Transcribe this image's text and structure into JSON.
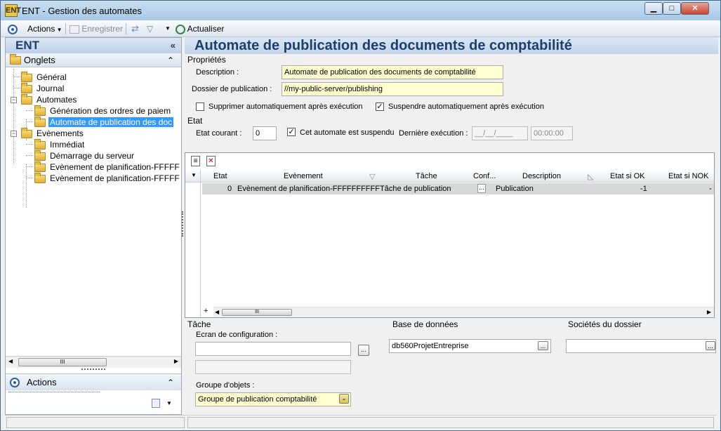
{
  "window": {
    "app_name": "ENT",
    "title": "ENT -  Gestion des automates",
    "minimize": "▁",
    "maximize": "□",
    "close": "✕"
  },
  "toolbar": {
    "actions_label": "Actions",
    "save_label": "Enregistrer",
    "refresh_label": "Actualiser"
  },
  "left": {
    "header": "ENT",
    "collapse_icon": "«",
    "onglets_label": "Onglets",
    "expand_icon": "⌃",
    "tree": [
      {
        "label": "Général"
      },
      {
        "label": "Journal"
      },
      {
        "label": "Automates"
      },
      {
        "label": "Génération des ordres de paiem"
      },
      {
        "label": "Automate de publication des doc"
      },
      {
        "label": "Evènements"
      },
      {
        "label": "Immédiat"
      },
      {
        "label": "Démarrage du serveur"
      },
      {
        "label": "Evènement de planification-FFFFF"
      },
      {
        "label": "Evènement de planification-FFFFF"
      }
    ],
    "actions_label": "Actions"
  },
  "main": {
    "title": "Automate de publication des documents de comptabilité",
    "proprietes_label": "Propriétés",
    "description_label": "Description :",
    "description_value": "Automate de publication des documents de comptabilité",
    "dossier_label": "Dossier de publication :",
    "dossier_value": "//my-public-server/publishing",
    "supprimer_label": "Supprimer automatiquement après exécution",
    "supprimer_checked": false,
    "suspendre_label": "Suspendre automatiquement après exécution",
    "suspendre_checked": true,
    "etat_label": "Etat",
    "etat_courant_label": "Etat courant :",
    "etat_courant_value": "0",
    "suspendu_label": "Cet automate est suspendu",
    "suspendu_checked": true,
    "derniere_label": "Dernière exécution :",
    "derniere_date": "__/__/____",
    "derniere_time": "00:00:00"
  },
  "grid": {
    "columns": [
      "Etat",
      "Evènement",
      "Tâche",
      "Conf...",
      "Description",
      "Etat si OK",
      "Etat si NOK"
    ],
    "rows": [
      {
        "etat": "0",
        "evenement": "Evènement de planification-FFFFFFFFFF",
        "tache": "Tâche de publication",
        "conf": "...",
        "description": "Publication",
        "etat_ok": "-1",
        "etat_nok": "-"
      }
    ]
  },
  "bottom": {
    "tache_label": "Tâche",
    "ecran_label": "Ecran de configuration :",
    "ecran_value": "",
    "groupe_label": "Groupe d'objets :",
    "groupe_value": "Groupe de publication comptabilité",
    "base_label": "Base de données",
    "base_value": "db560ProjetEntreprise",
    "societes_label": "Sociétés du dossier",
    "ellipsis": "..."
  }
}
